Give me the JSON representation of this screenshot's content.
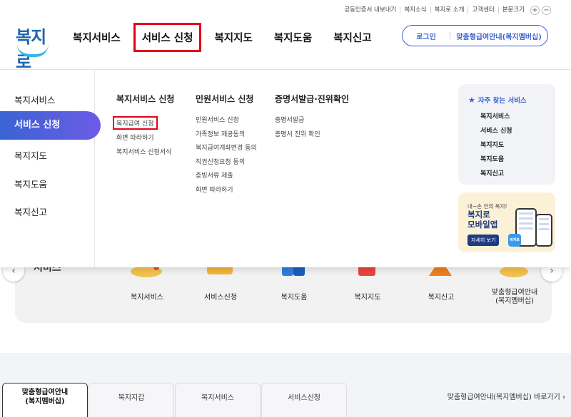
{
  "topbar": {
    "items": [
      "공동인증서 내보내기",
      "복지소식",
      "복지로 소개",
      "고객센터",
      "본문크기"
    ],
    "plus": "+",
    "minus": "−"
  },
  "logo": {
    "text": "복지로"
  },
  "gnb": {
    "items": [
      "복지서비스",
      "서비스 신청",
      "복지지도",
      "복지도움",
      "복지신고"
    ],
    "active_index": 1
  },
  "account": {
    "login": "로그인",
    "guide": "맞춤형급여안내(복지멤버십)"
  },
  "mega": {
    "side": [
      "복지서비스",
      "서비스 신청",
      "복지지도",
      "복지도움",
      "복지신고"
    ],
    "columns": [
      {
        "title": "복지서비스 신청",
        "items": [
          "복지급여 신청",
          "화면 따라하기",
          "복지서비스 신청서식"
        ]
      },
      {
        "title": "민원서비스 신청",
        "items": [
          "민원서비스 신청",
          "가족정보 제공동의",
          "복지급여계좌변경 동의",
          "직권신청요청 동의",
          "증빙서류 제출",
          "화면 따라하기"
        ]
      },
      {
        "title": "증명서발급·진위확인",
        "items": [
          "증명서발급",
          "증명서 진위 확인"
        ]
      }
    ],
    "favorites": {
      "title": "자주 찾는 서비스",
      "items": [
        "복지서비스",
        "서비스 신청",
        "복지지도",
        "복지도움",
        "복지신고"
      ]
    },
    "app_banner": {
      "small": "내~손 안의 복지!",
      "line1": "복지로",
      "line2": "모바일앱",
      "button": "자세히 보기",
      "badge": "복지로"
    }
  },
  "quick": {
    "heading": "서비스",
    "items": [
      "복지서비스",
      "서비스신청",
      "복지도움",
      "복지지도",
      "복지신고",
      "맞춤형급여안내\n(복지멤버십)"
    ],
    "icon_colors": [
      "#f2c14e",
      "#f2b53a",
      "#2f7de1",
      "#e8453c",
      "#f07d1f",
      "#f2c14e"
    ]
  },
  "bottom": {
    "tabs": [
      "맞춤형급여안내\n(복지멤버십)",
      "복지지갑",
      "복지서비스",
      "서비스신청"
    ],
    "more": "맞춤형급여안내(복지멤버십) 바로가기 ›"
  }
}
